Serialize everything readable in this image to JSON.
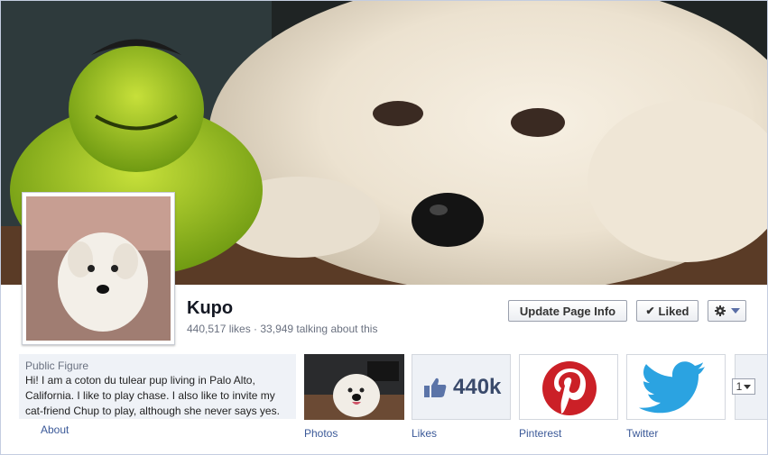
{
  "page": {
    "name": "Kupo",
    "stats": "440,517 likes · 33,949 talking about this"
  },
  "actions": {
    "update_label": "Update Page Info",
    "liked_label": "Liked",
    "check_glyph": "✔",
    "gear_icon": "gear-icon"
  },
  "about": {
    "category": "Public Figure",
    "text": "Hi! I am a coton du tulear pup living in Palo Alto, California. I like to play chase. I also like to invite my cat-friend Chup to play, although she never says yes.",
    "link": "About"
  },
  "apps": [
    {
      "label": "Photos"
    },
    {
      "label": "Likes",
      "count": "440k"
    },
    {
      "label": "Pinterest"
    },
    {
      "label": "Twitter"
    }
  ],
  "more_count": "1",
  "colors": {
    "link": "#3b5998",
    "pinterest": "#cb2027",
    "twitter": "#2ba3e1",
    "like_thumb": "#5b74a8"
  }
}
